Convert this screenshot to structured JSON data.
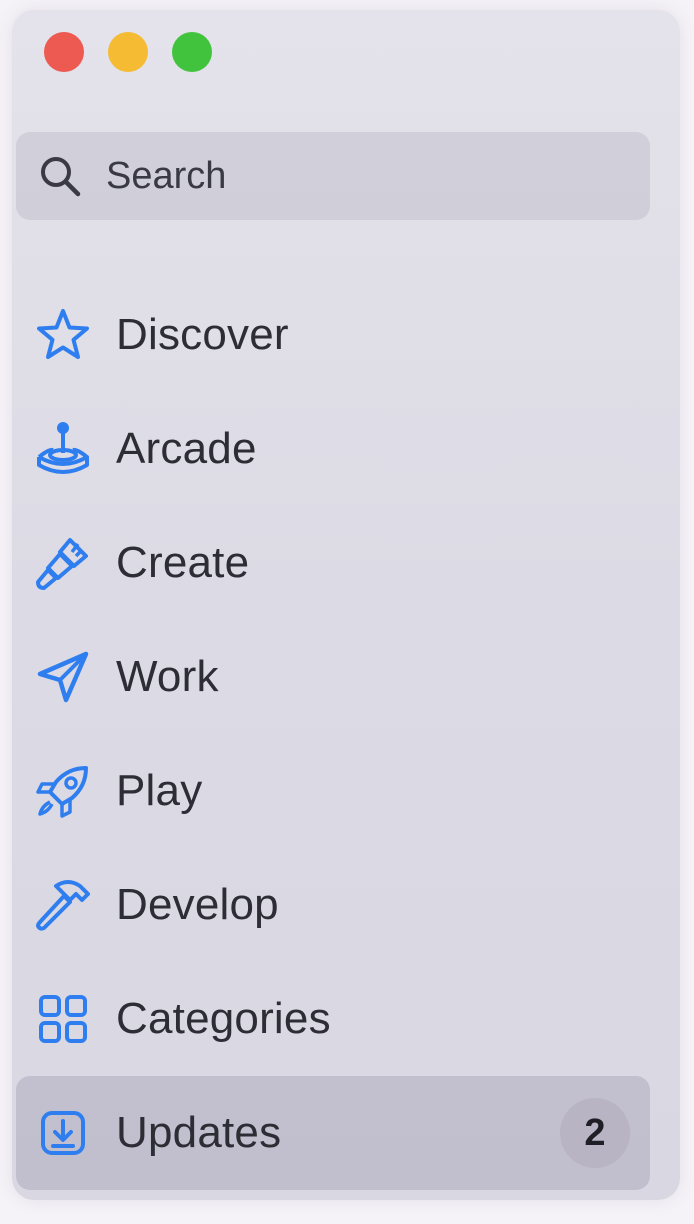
{
  "window": {
    "controls": [
      "close",
      "minimize",
      "maximize"
    ]
  },
  "search": {
    "placeholder": "Search"
  },
  "colors": {
    "accent": "#2f7ef0",
    "close": "#ec5a51",
    "minimize": "#f4bb33",
    "maximize": "#42c33e"
  },
  "sidebar": {
    "items": [
      {
        "label": "Discover",
        "icon": "star-icon"
      },
      {
        "label": "Arcade",
        "icon": "joystick-icon"
      },
      {
        "label": "Create",
        "icon": "paintbrush-icon"
      },
      {
        "label": "Work",
        "icon": "paperplane-icon"
      },
      {
        "label": "Play",
        "icon": "rocket-icon"
      },
      {
        "label": "Develop",
        "icon": "hammer-icon"
      },
      {
        "label": "Categories",
        "icon": "grid-icon"
      },
      {
        "label": "Updates",
        "icon": "download-icon",
        "badge": "2",
        "selected": true
      }
    ]
  }
}
